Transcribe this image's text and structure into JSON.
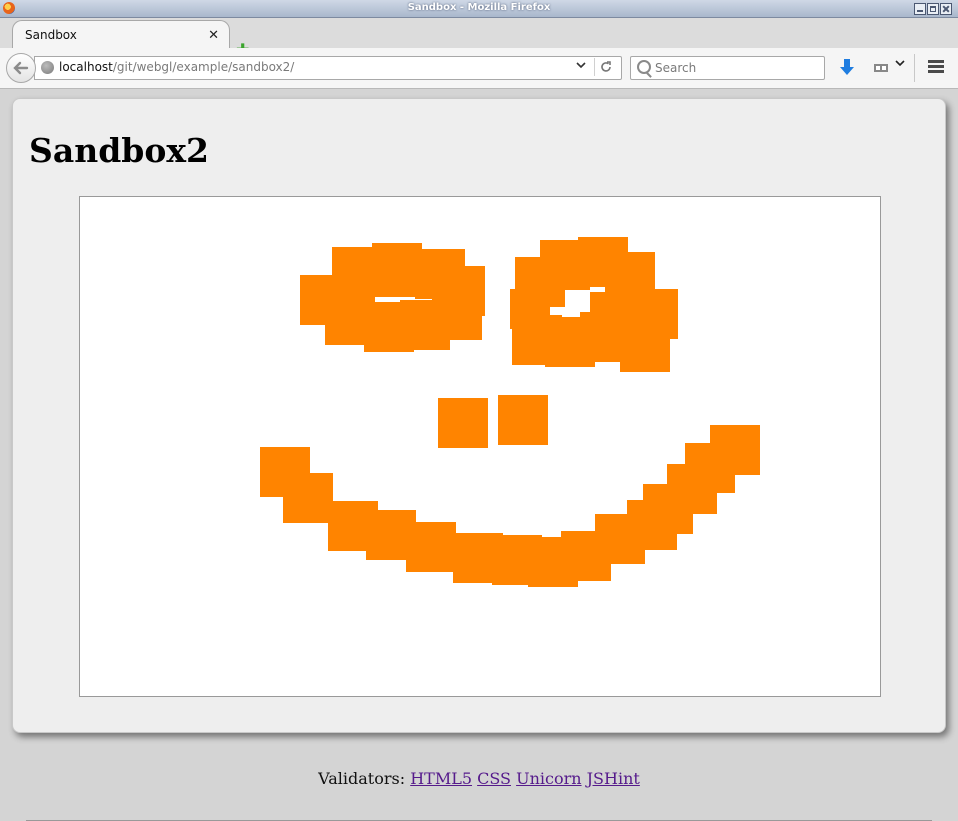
{
  "window": {
    "title": "Sandbox - Mozilla Firefox"
  },
  "tab": {
    "label": "Sandbox",
    "close": "✕",
    "new_tab": "✚"
  },
  "nav": {
    "url_host": "localhost",
    "url_path": "/git/webgl/example/sandbox2/",
    "search_placeholder": "Search"
  },
  "page": {
    "heading": "Sandbox2",
    "validators_label": "Validators:",
    "validator_links": [
      "HTML5",
      "CSS",
      "Unicorn",
      "JSHint"
    ]
  },
  "colors": {
    "paint": "#ff8400",
    "link": "#551a8b"
  },
  "icons": [
    "firefox-icon",
    "back-arrow-icon",
    "globe-icon",
    "chevron-down-icon",
    "reload-icon",
    "search-icon",
    "download-icon",
    "addon-icon",
    "hamburger-menu-icon",
    "close-icon",
    "plus-icon"
  ]
}
